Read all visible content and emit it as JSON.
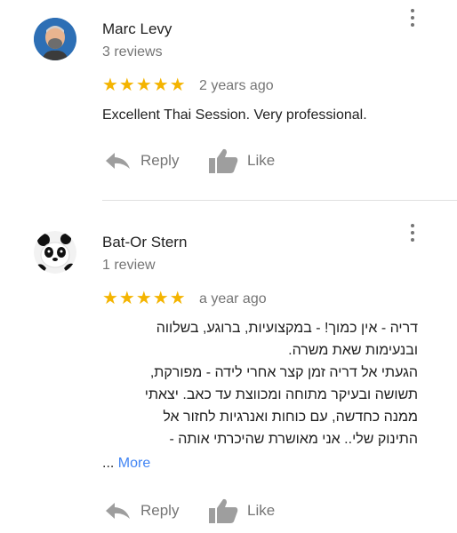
{
  "reviews": [
    {
      "author": "Marc Levy",
      "review_count": "3 reviews",
      "stars": "★★★★★",
      "rating": 5,
      "date": "2 years ago",
      "text": "Excellent Thai Session. Very professional.",
      "reply_label": "Reply",
      "like_label": "Like"
    },
    {
      "author": "Bat-Or Stern",
      "review_count": "1 review",
      "stars": "★★★★★",
      "rating": 5,
      "date": "a year ago",
      "text_lines": [
        "דריה - אין כמוך! - במקצועיות, ברוגע, בשלווה",
        "ובנעימות שאת משרה.",
        "הגעתי אל דריה זמן קצר אחרי לידה - מפורקת,",
        "תשושה ובעיקר מתוחה ומכווצת עד כאב. יצאתי",
        "ממנה כחדשה, עם כוחות ואנרגיות לחזור אל",
        "התינוק שלי.. אני מאושרת שהיכרתי אותה -"
      ],
      "ellipsis": "...",
      "more_label": "More",
      "reply_label": "Reply",
      "like_label": "Like"
    }
  ],
  "colors": {
    "star": "#f4b400",
    "link": "#4285f4",
    "secondary": "#757575"
  },
  "icons": [
    "avatar-marc",
    "avatar-panda",
    "more-vert-icon",
    "reply-arrow-icon",
    "thumbs-up-icon"
  ]
}
